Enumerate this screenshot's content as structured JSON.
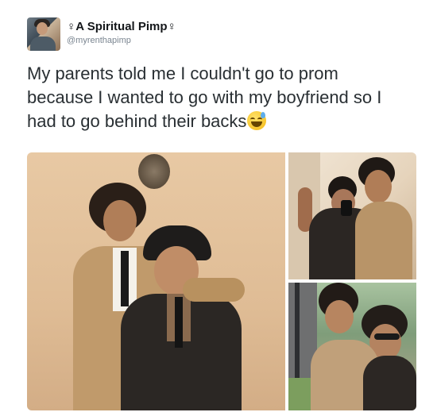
{
  "user": {
    "display_name": "♀A Spiritual Pimp♀",
    "handle": "@myrenthapimp",
    "avatar_icon": "profile-photo"
  },
  "tweet": {
    "text_lines": [
      "My parents told me I couldn't go to prom",
      "because I wanted to go with my boyfriend so I",
      "had to go behind their backs"
    ],
    "emoji_icon": "grinning-face-with-sweat-emoji"
  },
  "media": {
    "photo_count": 3,
    "photos": [
      {
        "name": "prom-photo-main"
      },
      {
        "name": "prom-photo-selfie"
      },
      {
        "name": "prom-photo-outdoors"
      }
    ]
  },
  "colors": {
    "name_text": "#14171a",
    "handle_text": "#7a8590",
    "body_text": "#292f33"
  }
}
